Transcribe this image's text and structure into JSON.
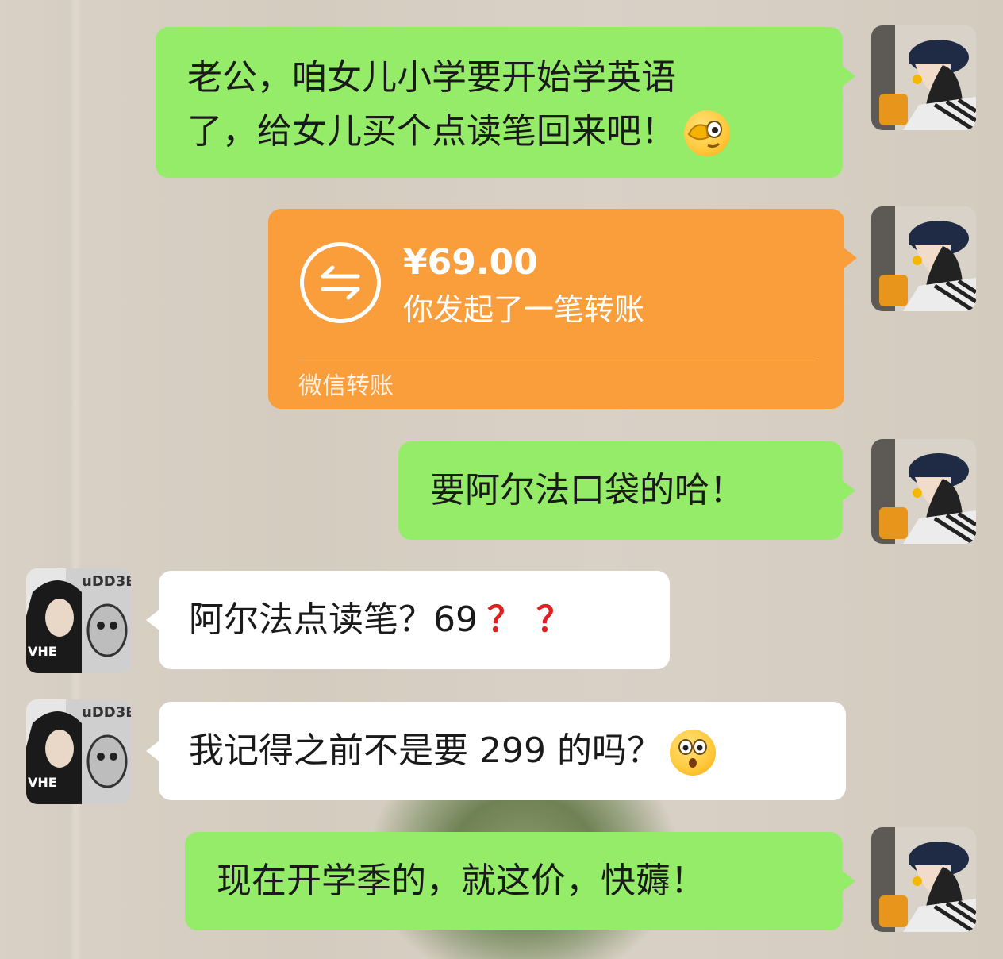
{
  "messages": [
    {
      "side": "me",
      "type": "text",
      "text": "老公，咱女儿小学要开始学英语了，给女儿买个点读笔回来吧！",
      "line1": "老公，咱女儿小学要开始学英语",
      "line2": "了，给女儿买个点读笔回来吧！",
      "emoji": "facepalm-peek-emoji"
    },
    {
      "side": "me",
      "type": "transfer",
      "amount": "¥69.00",
      "note": "你发起了一笔转账",
      "footer": "微信转账"
    },
    {
      "side": "me",
      "type": "text",
      "text": "要阿尔法口袋的哈！"
    },
    {
      "side": "other",
      "type": "text",
      "text": "阿尔法点读笔？69",
      "marks": "？？"
    },
    {
      "side": "other",
      "type": "text",
      "text": "我记得之前不是要 299 的吗？",
      "emoji": "astonished-emoji"
    },
    {
      "side": "me",
      "type": "text",
      "text": "现在开学季的，就这价，快薅！"
    }
  ],
  "colors": {
    "me_bubble": "#95ec69",
    "other_bubble": "#ffffff",
    "transfer": "#fa9d3b",
    "question_mark": "#e02020"
  }
}
